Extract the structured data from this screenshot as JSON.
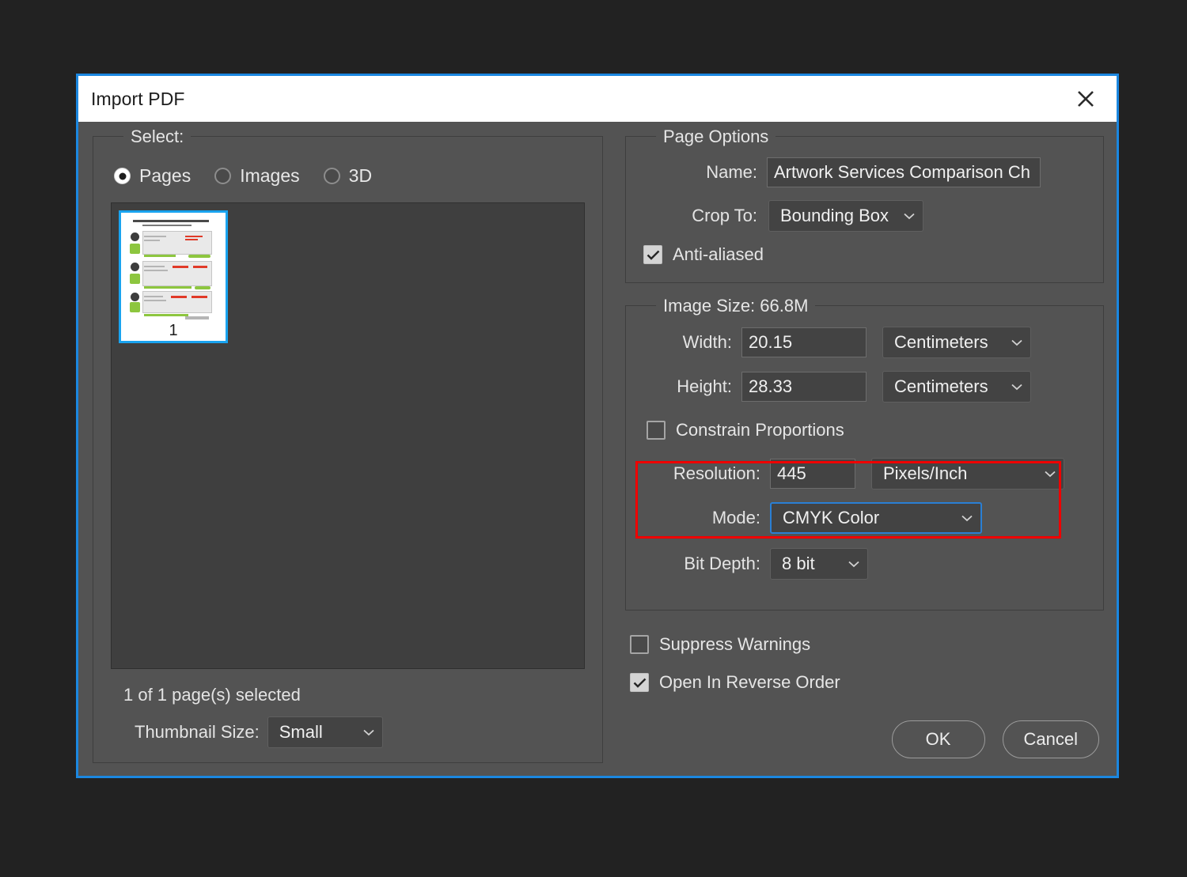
{
  "dialog": {
    "title": "Import PDF",
    "close_icon": "close-icon",
    "border_color": "#1b87e0",
    "background": "#535353"
  },
  "select_panel": {
    "group_label": "Select:",
    "radios": [
      {
        "label": "Pages",
        "selected": true
      },
      {
        "label": "Images",
        "selected": false
      },
      {
        "label": "3D",
        "selected": false
      }
    ],
    "thumbnails": [
      {
        "page_number": "1",
        "selected": true
      }
    ],
    "selection_status": "1 of 1 page(s) selected",
    "thumbnail_size_label": "Thumbnail Size:",
    "thumbnail_size_value": "Small",
    "selection_highlight_color": "#19a3ef"
  },
  "page_options": {
    "group_label": "Page Options",
    "name_label": "Name:",
    "name_value": "Artwork Services Comparison Ch",
    "crop_to_label": "Crop To:",
    "crop_to_value": "Bounding Box",
    "anti_aliased_label": "Anti-aliased",
    "anti_aliased_checked": true
  },
  "image_size": {
    "group_label": "Image Size: 66.8M",
    "width_label": "Width:",
    "width_value": "20.15",
    "width_unit": "Centimeters",
    "height_label": "Height:",
    "height_value": "28.33",
    "height_unit": "Centimeters",
    "constrain_label": "Constrain Proportions",
    "constrain_checked": false,
    "resolution_label": "Resolution:",
    "resolution_value": "445",
    "resolution_unit": "Pixels/Inch",
    "mode_label": "Mode:",
    "mode_value": "CMYK Color",
    "mode_focus_color": "#2a7fd4",
    "bit_depth_label": "Bit Depth:",
    "bit_depth_value": "8 bit",
    "highlight_box_color": "#ef0000"
  },
  "options": {
    "suppress_warnings_label": "Suppress Warnings",
    "suppress_warnings_checked": false,
    "open_reverse_label": "Open In Reverse Order",
    "open_reverse_checked": true
  },
  "actions": {
    "ok_label": "OK",
    "cancel_label": "Cancel"
  }
}
